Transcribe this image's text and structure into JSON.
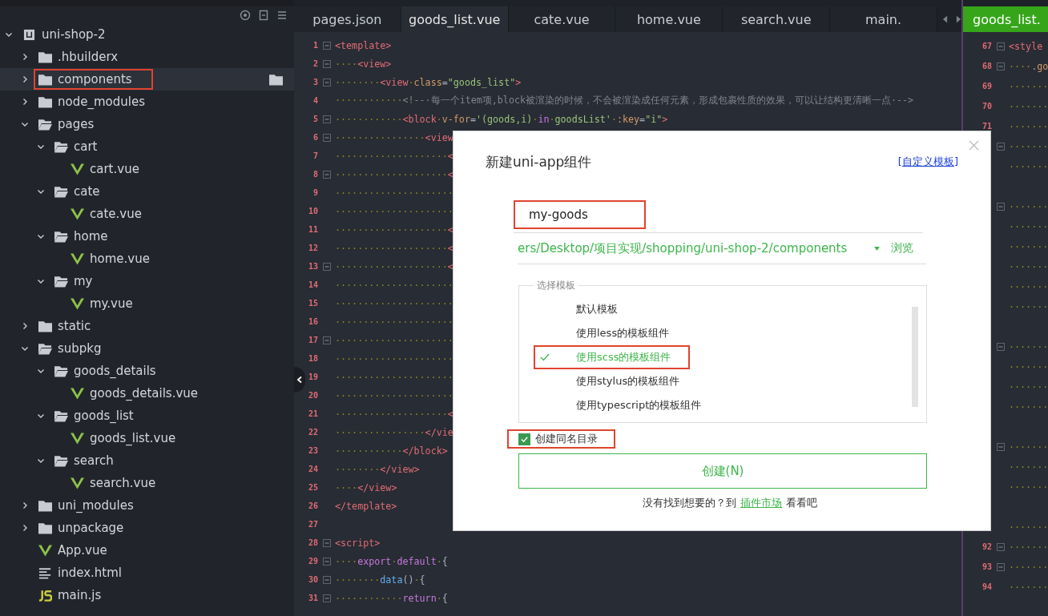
{
  "sidebar": {
    "tree": [
      {
        "name": "uni-shop-2",
        "kind": "project",
        "expanded": true,
        "selected": false,
        "highlighted": false,
        "children": [
          {
            "name": ".hbuilderx",
            "kind": "folder",
            "expanded": false,
            "selected": false,
            "highlighted": false
          },
          {
            "name": "components",
            "kind": "folder",
            "expanded": false,
            "selected": true,
            "highlighted": true
          },
          {
            "name": "node_modules",
            "kind": "folder",
            "expanded": false,
            "selected": false,
            "highlighted": false
          },
          {
            "name": "pages",
            "kind": "folder",
            "expanded": true,
            "selected": false,
            "highlighted": false,
            "children": [
              {
                "name": "cart",
                "kind": "folder",
                "expanded": true,
                "selected": false,
                "highlighted": false,
                "children": [
                  {
                    "name": "cart.vue",
                    "kind": "vue",
                    "selected": false,
                    "highlighted": false
                  }
                ]
              },
              {
                "name": "cate",
                "kind": "folder",
                "expanded": true,
                "selected": false,
                "highlighted": false,
                "children": [
                  {
                    "name": "cate.vue",
                    "kind": "vue",
                    "selected": false,
                    "highlighted": false
                  }
                ]
              },
              {
                "name": "home",
                "kind": "folder",
                "expanded": true,
                "selected": false,
                "highlighted": false,
                "children": [
                  {
                    "name": "home.vue",
                    "kind": "vue",
                    "selected": false,
                    "highlighted": false
                  }
                ]
              },
              {
                "name": "my",
                "kind": "folder",
                "expanded": true,
                "selected": false,
                "highlighted": false,
                "children": [
                  {
                    "name": "my.vue",
                    "kind": "vue",
                    "selected": false,
                    "highlighted": false
                  }
                ]
              }
            ]
          },
          {
            "name": "static",
            "kind": "folder",
            "expanded": false,
            "selected": false,
            "highlighted": false
          },
          {
            "name": "subpkg",
            "kind": "folder",
            "expanded": true,
            "selected": false,
            "highlighted": false,
            "children": [
              {
                "name": "goods_details",
                "kind": "folder",
                "expanded": true,
                "selected": false,
                "highlighted": false,
                "children": [
                  {
                    "name": "goods_details.vue",
                    "kind": "vue",
                    "selected": false,
                    "highlighted": false
                  }
                ]
              },
              {
                "name": "goods_list",
                "kind": "folder",
                "expanded": true,
                "selected": false,
                "highlighted": false,
                "children": [
                  {
                    "name": "goods_list.vue",
                    "kind": "vue",
                    "selected": false,
                    "highlighted": false
                  }
                ]
              },
              {
                "name": "search",
                "kind": "folder",
                "expanded": true,
                "selected": false,
                "highlighted": false,
                "children": [
                  {
                    "name": "search.vue",
                    "kind": "vue",
                    "selected": false,
                    "highlighted": false
                  }
                ]
              }
            ]
          },
          {
            "name": "uni_modules",
            "kind": "folder",
            "expanded": false,
            "selected": false,
            "highlighted": false
          },
          {
            "name": "unpackage",
            "kind": "folder",
            "expanded": false,
            "selected": false,
            "highlighted": false
          },
          {
            "name": "App.vue",
            "kind": "vue",
            "selected": false,
            "highlighted": false
          },
          {
            "name": "index.html",
            "kind": "html",
            "selected": false,
            "highlighted": false
          },
          {
            "name": "main.js",
            "kind": "js",
            "selected": false,
            "highlighted": false
          }
        ]
      }
    ]
  },
  "editor": {
    "tabs": [
      {
        "label": "pages.json",
        "selected": false
      },
      {
        "label": "goods_list.vue",
        "selected": true
      },
      {
        "label": "cate.vue",
        "selected": false
      },
      {
        "label": "home.vue",
        "selected": false
      },
      {
        "label": "search.vue",
        "selected": false
      },
      {
        "label": "main.",
        "selected": false
      }
    ],
    "lines": [
      {
        "number": "1",
        "fold": true,
        "tokens": [
          {
            "kind": "tag",
            "text": "<template>"
          }
        ]
      },
      {
        "number": "2",
        "fold": true,
        "tokens": [
          {
            "kind": "ws",
            "text": "····"
          },
          {
            "kind": "tag",
            "text": "<view>"
          }
        ]
      },
      {
        "number": "3",
        "fold": true,
        "tokens": [
          {
            "kind": "ws",
            "text": "········"
          },
          {
            "kind": "tag",
            "text": "<view"
          },
          {
            "kind": "ws",
            "text": "·"
          },
          {
            "kind": "attr",
            "text": "class"
          },
          {
            "kind": "punct",
            "text": "="
          },
          {
            "kind": "str",
            "text": "\"goods_list\""
          },
          {
            "kind": "tag",
            "text": ">"
          }
        ]
      },
      {
        "number": "4",
        "fold": false,
        "tokens": [
          {
            "kind": "ws",
            "text": "············"
          },
          {
            "kind": "comment",
            "text": "<!--·每一个item项,block被渲染的时候，不会被渲染成任何元素，形成包裹性质的效果，可以让结构更清晰一点·-->"
          }
        ]
      },
      {
        "number": "5",
        "fold": true,
        "tokens": [
          {
            "kind": "ws",
            "text": "············"
          },
          {
            "kind": "tag",
            "text": "<block"
          },
          {
            "kind": "ws",
            "text": "·"
          },
          {
            "kind": "attr",
            "text": "v-for"
          },
          {
            "kind": "punct",
            "text": "="
          },
          {
            "kind": "str",
            "text": "'(goods,i)"
          },
          {
            "kind": "ws",
            "text": "·"
          },
          {
            "kind": "kw",
            "text": "in"
          },
          {
            "kind": "ws",
            "text": "·"
          },
          {
            "kind": "str",
            "text": "goodsList'"
          },
          {
            "kind": "ws",
            "text": "·"
          },
          {
            "kind": "attr",
            "text": ":key"
          },
          {
            "kind": "punct",
            "text": "="
          },
          {
            "kind": "str",
            "text": "\"i\""
          },
          {
            "kind": "tag",
            "text": ">"
          }
        ]
      },
      {
        "number": "6",
        "fold": true,
        "tokens": [
          {
            "kind": "ws",
            "text": "················"
          },
          {
            "kind": "tag",
            "text": "<view"
          }
        ]
      },
      {
        "number": "7",
        "fold": false,
        "tokens": [
          {
            "kind": "ws",
            "text": "····················"
          },
          {
            "kind": "tag",
            "text": "<"
          }
        ]
      },
      {
        "number": "8",
        "fold": true,
        "tokens": [
          {
            "kind": "ws",
            "text": "····················"
          },
          {
            "kind": "tag",
            "text": "<"
          }
        ]
      },
      {
        "number": "9",
        "fold": false,
        "tokens": [
          {
            "kind": "ws",
            "text": "·····················"
          }
        ]
      },
      {
        "number": "10",
        "fold": false,
        "tokens": [
          {
            "kind": "ws",
            "text": "·····················"
          }
        ]
      },
      {
        "number": "11",
        "fold": false,
        "tokens": [
          {
            "kind": "ws",
            "text": "····················"
          },
          {
            "kind": "tag",
            "text": "<"
          }
        ]
      },
      {
        "number": "12",
        "fold": false,
        "tokens": [
          {
            "kind": "ws",
            "text": "····················"
          },
          {
            "kind": "tag",
            "text": "<"
          }
        ]
      },
      {
        "number": "13",
        "fold": true,
        "tokens": [
          {
            "kind": "ws",
            "text": "····················"
          },
          {
            "kind": "tag",
            "text": "<"
          }
        ]
      },
      {
        "number": "14",
        "fold": false,
        "tokens": [
          {
            "kind": "ws",
            "text": "·····················"
          }
        ]
      },
      {
        "number": "15",
        "fold": false,
        "tokens": [
          {
            "kind": "ws",
            "text": "·····················"
          }
        ]
      },
      {
        "number": "16",
        "fold": false,
        "tokens": [
          {
            "kind": "ws",
            "text": "·····················"
          }
        ]
      },
      {
        "number": "17",
        "fold": true,
        "tokens": [
          {
            "kind": "ws",
            "text": "·····················"
          }
        ]
      },
      {
        "number": "18",
        "fold": false,
        "tokens": [
          {
            "kind": "ws",
            "text": "·····················"
          }
        ]
      },
      {
        "number": "19",
        "fold": false,
        "tokens": [
          {
            "kind": "ws",
            "text": "·····················"
          }
        ]
      },
      {
        "number": "20",
        "fold": false,
        "tokens": [
          {
            "kind": "ws",
            "text": "·····················"
          }
        ]
      },
      {
        "number": "21",
        "fold": false,
        "tokens": [
          {
            "kind": "ws",
            "text": "····················"
          },
          {
            "kind": "tag",
            "text": "<"
          }
        ]
      },
      {
        "number": "22",
        "fold": false,
        "tokens": [
          {
            "kind": "ws",
            "text": "················"
          },
          {
            "kind": "tag",
            "text": "</vie"
          }
        ]
      },
      {
        "number": "23",
        "fold": false,
        "tokens": [
          {
            "kind": "ws",
            "text": "············"
          },
          {
            "kind": "tag",
            "text": "</block>"
          }
        ]
      },
      {
        "number": "24",
        "fold": false,
        "tokens": [
          {
            "kind": "ws",
            "text": "········"
          },
          {
            "kind": "tag",
            "text": "</view>"
          }
        ]
      },
      {
        "number": "25",
        "fold": false,
        "tokens": [
          {
            "kind": "ws",
            "text": "····"
          },
          {
            "kind": "tag",
            "text": "</view>"
          }
        ]
      },
      {
        "number": "26",
        "fold": false,
        "tokens": [
          {
            "kind": "tag",
            "text": "</template>"
          }
        ]
      },
      {
        "number": "27",
        "fold": false
      },
      {
        "number": "28",
        "fold": true,
        "tokens": [
          {
            "kind": "tag",
            "text": "<script>"
          }
        ]
      },
      {
        "number": "29",
        "fold": true,
        "tokens": [
          {
            "kind": "ws",
            "text": "····"
          },
          {
            "kind": "kw",
            "text": "export"
          },
          {
            "kind": "ws",
            "text": "·"
          },
          {
            "kind": "kw",
            "text": "default"
          },
          {
            "kind": "ws",
            "text": "·"
          },
          {
            "kind": "punct",
            "text": "{"
          }
        ]
      },
      {
        "number": "30",
        "fold": true,
        "tokens": [
          {
            "kind": "ws",
            "text": "········"
          },
          {
            "kind": "fn",
            "text": "data"
          },
          {
            "kind": "punct",
            "text": "()"
          },
          {
            "kind": "ws",
            "text": "·"
          },
          {
            "kind": "punct",
            "text": "{"
          }
        ]
      },
      {
        "number": "31",
        "fold": true,
        "tokens": [
          {
            "kind": "ws",
            "text": "············"
          },
          {
            "kind": "kw",
            "text": "return"
          },
          {
            "kind": "ws",
            "text": "·"
          },
          {
            "kind": "punct",
            "text": "{"
          }
        ]
      }
    ]
  },
  "split_editor": {
    "tab": {
      "label": "goods_list.",
      "selected": true
    },
    "lines": [
      {
        "number": "67",
        "fold": true,
        "tokens": [
          {
            "kind": "tag",
            "text": "<style"
          }
        ]
      },
      {
        "number": "68",
        "fold": true,
        "tokens": [
          {
            "kind": "ws",
            "text": "····"
          },
          {
            "kind": "attr",
            "text": ".go"
          }
        ]
      },
      {
        "number": "69",
        "fold": false,
        "tokens": [
          {
            "kind": "ws",
            "text": "·······"
          }
        ]
      },
      {
        "number": "70",
        "fold": false,
        "tokens": [
          {
            "kind": "ws",
            "text": "·······"
          }
        ]
      },
      {
        "number": "71",
        "fold": false,
        "tokens": [
          {
            "kind": "ws",
            "text": "·······"
          }
        ]
      },
      {
        "fold": true,
        "tokens": [
          {
            "kind": "ws",
            "text": "·······"
          }
        ]
      },
      {
        "fold": false,
        "tokens": [
          {
            "kind": "ws",
            "text": "·······"
          }
        ]
      },
      {
        "fold": false
      },
      {
        "fold": true,
        "tokens": [
          {
            "kind": "ws",
            "text": "·······"
          }
        ]
      },
      {
        "fold": false,
        "tokens": [
          {
            "kind": "ws",
            "text": "·······"
          }
        ]
      },
      {
        "fold": false,
        "tokens": [
          {
            "kind": "ws",
            "text": "·······"
          }
        ]
      },
      {
        "fold": false,
        "tokens": [
          {
            "kind": "ws",
            "text": "·······"
          }
        ]
      },
      {
        "fold": false,
        "tokens": [
          {
            "kind": "ws",
            "text": "·······"
          }
        ]
      },
      {
        "fold": false,
        "tokens": [
          {
            "kind": "ws",
            "text": "·······"
          }
        ]
      },
      {
        "fold": false
      },
      {
        "fold": true,
        "tokens": [
          {
            "kind": "ws",
            "text": "·······"
          }
        ]
      },
      {
        "fold": false,
        "tokens": [
          {
            "kind": "ws",
            "text": "·······"
          }
        ]
      },
      {
        "fold": false,
        "tokens": [
          {
            "kind": "ws",
            "text": "·······"
          }
        ]
      },
      {
        "fold": false,
        "tokens": [
          {
            "kind": "ws",
            "text": "·······"
          }
        ]
      },
      {
        "fold": false
      },
      {
        "fold": true,
        "tokens": [
          {
            "kind": "ws",
            "text": "·······"
          }
        ]
      },
      {
        "fold": false,
        "tokens": [
          {
            "kind": "ws",
            "text": "·······"
          }
        ]
      },
      {
        "fold": false,
        "tokens": [
          {
            "kind": "ws",
            "text": "·······"
          }
        ]
      },
      {
        "fold": false
      },
      {
        "fold": false,
        "tokens": [
          {
            "kind": "ws",
            "text": "·······"
          }
        ]
      },
      {
        "number": "92",
        "fold": true,
        "tokens": [
          {
            "kind": "ws",
            "text": "·······"
          }
        ]
      },
      {
        "number": "93",
        "fold": true,
        "tokens": [
          {
            "kind": "ws",
            "text": "·······"
          }
        ]
      },
      {
        "number": "94",
        "fold": false,
        "tokens": [
          {
            "kind": "ws",
            "text": "·······"
          }
        ]
      }
    ]
  },
  "dialog": {
    "title": "新建uni-app组件",
    "template_link": "[自定义模板]",
    "name_field": {
      "value": "my-goods",
      "highlighted": true
    },
    "path_field": {
      "value": "ers/Desktop/项目实现/shopping/uni-shop-2/components",
      "browse": "浏览"
    },
    "template_group": {
      "legend": "选择模板",
      "options": [
        {
          "label": "默认模板",
          "selected": false,
          "highlighted": false
        },
        {
          "label": "使用less的模板组件",
          "selected": false,
          "highlighted": false
        },
        {
          "label": "使用scss的模板组件",
          "selected": true,
          "highlighted": true
        },
        {
          "label": "使用stylus的模板组件",
          "selected": false,
          "highlighted": false
        },
        {
          "label": "使用typescript的模板组件",
          "selected": false,
          "highlighted": false
        }
      ]
    },
    "same_name_dir": {
      "label": "创建同名目录",
      "checked": true,
      "highlighted": true
    },
    "create_button": "创建(N)",
    "footer": {
      "text_before": "没有找到想要的？到",
      "link": "插件市场",
      "text_after": "看看吧"
    }
  }
}
